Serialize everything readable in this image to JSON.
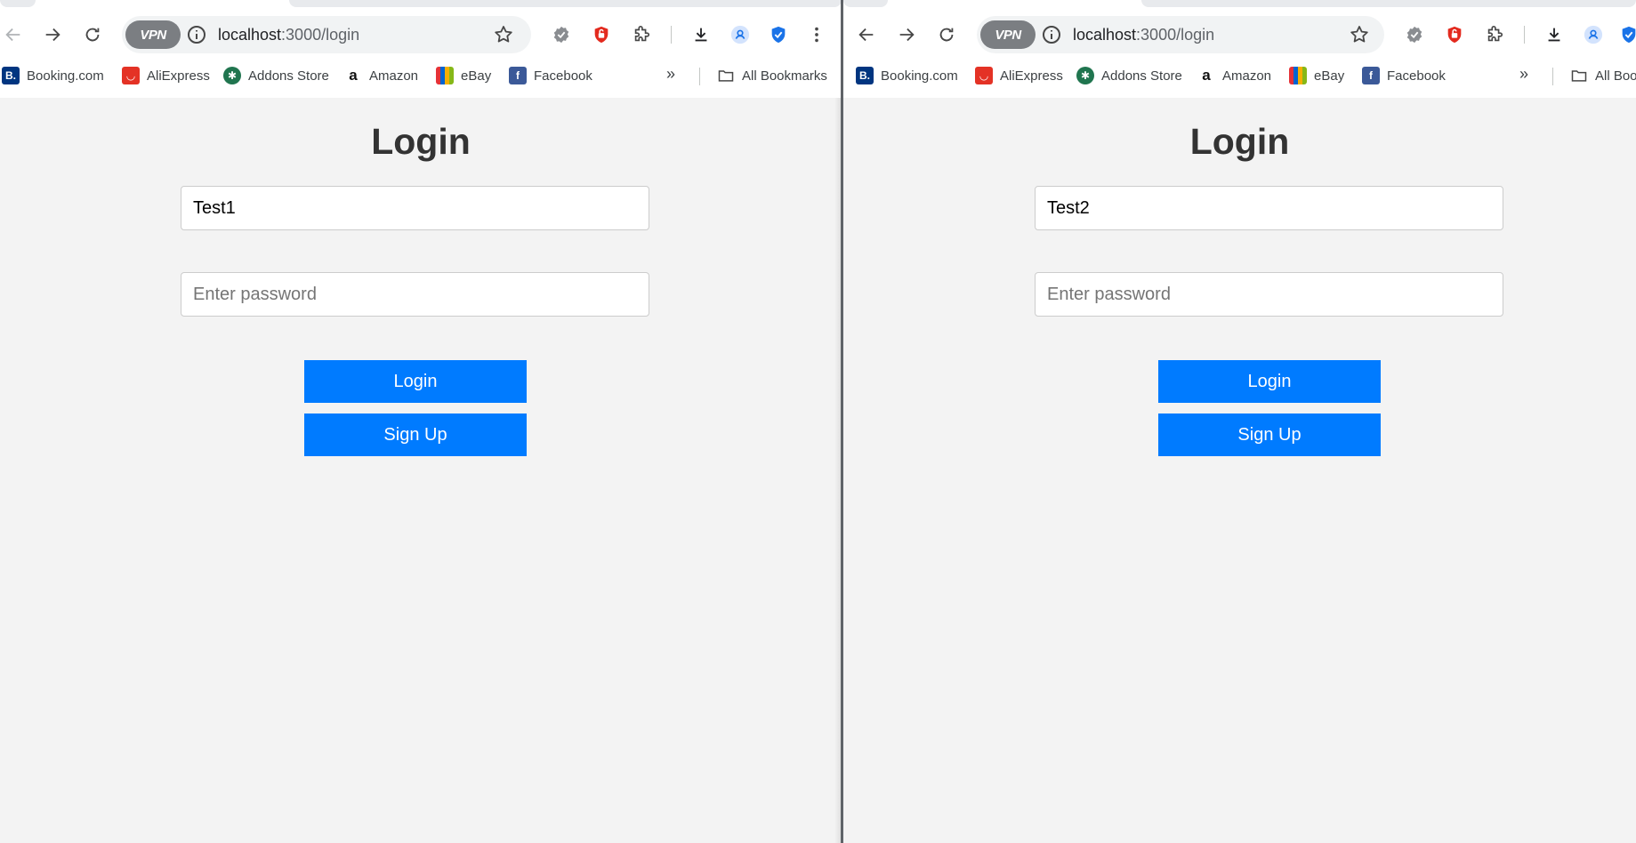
{
  "left": {
    "address": {
      "host": "localhost",
      "path": ":3000/login"
    },
    "vpn_label": "VPN",
    "bookmarks": {
      "items": [
        "Booking.com",
        "AliExpress",
        "Addons Store",
        "Amazon",
        "eBay",
        "Facebook"
      ],
      "more": "»",
      "all_bookmarks": "All Bookmarks"
    },
    "page": {
      "title": "Login",
      "username_value": "Test1",
      "password_placeholder": "Enter password",
      "login_label": "Login",
      "signup_label": "Sign Up"
    }
  },
  "right": {
    "address": {
      "host": "localhost",
      "path": ":3000/login"
    },
    "vpn_label": "VPN",
    "bookmarks": {
      "items": [
        "Booking.com",
        "AliExpress",
        "Addons Store",
        "Amazon",
        "eBay",
        "Facebook"
      ],
      "more": "»",
      "all_bookmarks": "All Boo"
    },
    "page": {
      "title": "Login",
      "username_value": "Test2",
      "password_placeholder": "Enter password",
      "login_label": "Login",
      "signup_label": "Sign Up"
    }
  },
  "colors": {
    "button_blue": "#007bff",
    "page_bg": "#f3f3f3",
    "title_text": "#333333",
    "booking": "#003580",
    "aliexpress": "#e43225",
    "addons": "#20754f",
    "facebook": "#3b5998",
    "shield_blue": "#1a73e8",
    "adblock_red": "#e32a1e"
  },
  "icons": {
    "back": "arrow-left-icon",
    "forward": "arrow-right-icon",
    "reload": "reload-icon",
    "info": "info-icon",
    "star": "star-icon",
    "extensions": "puzzle-icon",
    "download": "download-icon",
    "menu": "kebab-menu-icon",
    "folder": "folder-icon"
  }
}
